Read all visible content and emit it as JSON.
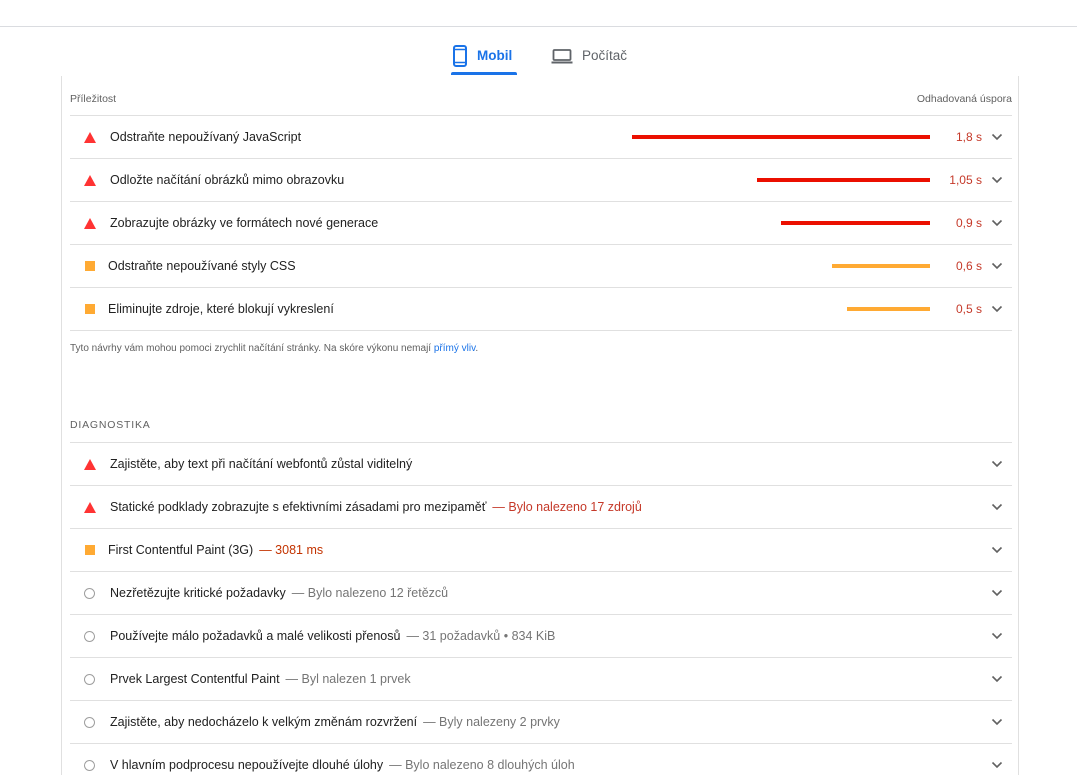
{
  "tabs": {
    "mobile": {
      "label": "Mobil",
      "icon": "smartphone-icon",
      "active": true
    },
    "desktop": {
      "label": "Počítač",
      "icon": "laptop-icon",
      "active": false
    }
  },
  "opportunities": {
    "header_left": "Příležitost",
    "header_right": "Odhadovaná úspora",
    "items": [
      {
        "status": "fail",
        "title": "Odstraňte nepoužívaný JavaScript",
        "savings": "1,8 s",
        "bar_fraction": 1.0
      },
      {
        "status": "fail",
        "title": "Odložte načítání obrázků mimo obrazovku",
        "savings": "1,05 s",
        "bar_fraction": 0.58
      },
      {
        "status": "fail",
        "title": "Zobrazujte obrázky ve formátech nové generace",
        "savings": "0,9 s",
        "bar_fraction": 0.5
      },
      {
        "status": "average",
        "title": "Odstraňte nepoužívané styly CSS",
        "savings": "0,6 s",
        "bar_fraction": 0.33
      },
      {
        "status": "average",
        "title": "Eliminujte zdroje, které blokují vykreslení",
        "savings": "0,5 s",
        "bar_fraction": 0.28
      }
    ],
    "note_text": "Tyto návrhy vám mohou pomoci zrychlit načítání stránky. Na skóre výkonu nemají",
    "note_link": "přímý vliv",
    "note_end": "."
  },
  "diagnostics": {
    "title": "DIAGNOSTIKA",
    "items": [
      {
        "status": "fail",
        "title": "Zajistěte, aby text při načítání webfontů zůstal viditelný",
        "detail": ""
      },
      {
        "status": "fail",
        "title": "Statické podklady zobrazujte s efektivními zásadami pro mezipaměť",
        "detail": "— Bylo nalezeno 17 zdrojů"
      },
      {
        "status": "average",
        "title": "First Contentful Paint (3G)",
        "detail": "— 3081 ms"
      },
      {
        "status": "info",
        "title": "Nezřetězujte kritické požadavky",
        "detail": "— Bylo nalezeno 12 řetězců"
      },
      {
        "status": "info",
        "title": "Používejte málo požadavků a malé velikosti přenosů",
        "detail": "— 31 požadavků • 834 KiB"
      },
      {
        "status": "info",
        "title": "Prvek Largest Contentful Paint",
        "detail": "— Byl nalezen 1 prvek"
      },
      {
        "status": "info",
        "title": "Zajistěte, aby nedocházelo k velkým změnám rozvržení",
        "detail": "— Byly nalezeny 2 prvky"
      },
      {
        "status": "info",
        "title": "V hlavním podprocesu nepoužívejte dlouhé úlohy",
        "detail": "— Bylo nalezeno 8 dlouhých úloh"
      }
    ]
  },
  "colors": {
    "accent": "#1a73e8",
    "fail": "#ff3333",
    "average": "#ffaa33",
    "info": "#9e9e9e",
    "fail_text": "#c53929"
  }
}
